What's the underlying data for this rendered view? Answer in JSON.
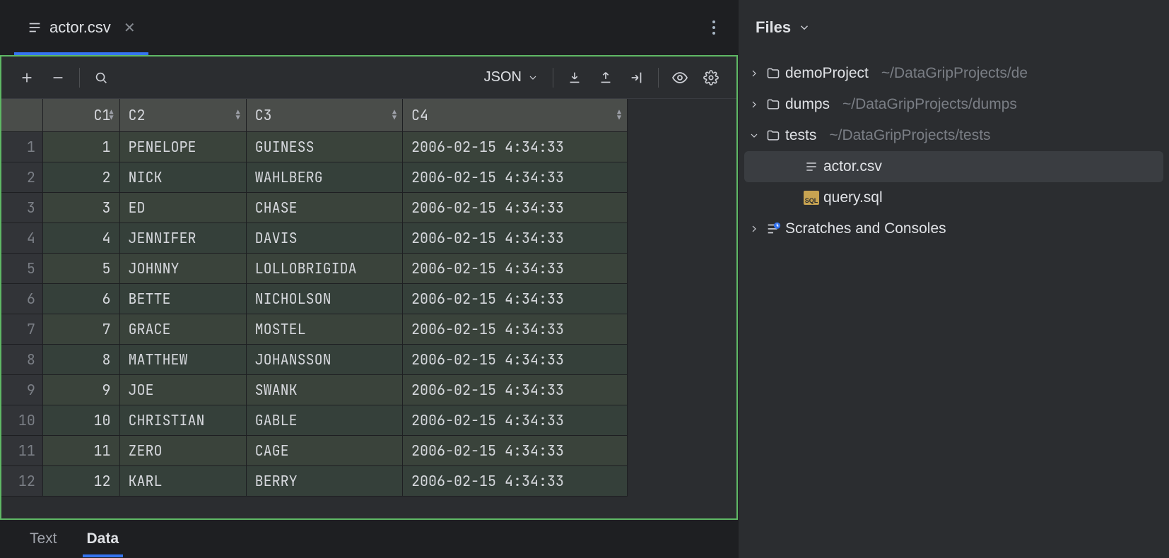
{
  "tab": {
    "title": "actor.csv"
  },
  "toolbar": {
    "format": "JSON"
  },
  "columns": [
    "C1",
    "C2",
    "C3",
    "C4"
  ],
  "rows": [
    {
      "n": "1",
      "c1": "1",
      "c2": "PENELOPE",
      "c3": "GUINESS",
      "c4": "2006-02-15 4:34:33"
    },
    {
      "n": "2",
      "c1": "2",
      "c2": "NICK",
      "c3": "WAHLBERG",
      "c4": "2006-02-15 4:34:33"
    },
    {
      "n": "3",
      "c1": "3",
      "c2": "ED",
      "c3": "CHASE",
      "c4": "2006-02-15 4:34:33"
    },
    {
      "n": "4",
      "c1": "4",
      "c2": "JENNIFER",
      "c3": "DAVIS",
      "c4": "2006-02-15 4:34:33"
    },
    {
      "n": "5",
      "c1": "5",
      "c2": "JOHNNY",
      "c3": "LOLLOBRIGIDA",
      "c4": "2006-02-15 4:34:33"
    },
    {
      "n": "6",
      "c1": "6",
      "c2": "BETTE",
      "c3": "NICHOLSON",
      "c4": "2006-02-15 4:34:33"
    },
    {
      "n": "7",
      "c1": "7",
      "c2": "GRACE",
      "c3": "MOSTEL",
      "c4": "2006-02-15 4:34:33"
    },
    {
      "n": "8",
      "c1": "8",
      "c2": "MATTHEW",
      "c3": "JOHANSSON",
      "c4": "2006-02-15 4:34:33"
    },
    {
      "n": "9",
      "c1": "9",
      "c2": "JOE",
      "c3": "SWANK",
      "c4": "2006-02-15 4:34:33"
    },
    {
      "n": "10",
      "c1": "10",
      "c2": "CHRISTIAN",
      "c3": "GABLE",
      "c4": "2006-02-15 4:34:33"
    },
    {
      "n": "11",
      "c1": "11",
      "c2": "ZERO",
      "c3": "CAGE",
      "c4": "2006-02-15 4:34:33"
    },
    {
      "n": "12",
      "c1": "12",
      "c2": "KARL",
      "c3": "BERRY",
      "c4": "2006-02-15 4:34:33"
    }
  ],
  "bottomTabs": {
    "text": "Text",
    "data": "Data"
  },
  "filesPanel": {
    "title": "Files",
    "nodes": {
      "demoProject": {
        "label": "demoProject",
        "sub": "~/DataGripProjects/de"
      },
      "dumps": {
        "label": "dumps",
        "sub": "~/DataGripProjects/dumps"
      },
      "tests": {
        "label": "tests",
        "sub": "~/DataGripProjects/tests"
      },
      "actorCsv": {
        "label": "actor.csv"
      },
      "querySql": {
        "label": "query.sql"
      },
      "scratches": {
        "label": "Scratches and Consoles"
      }
    }
  }
}
